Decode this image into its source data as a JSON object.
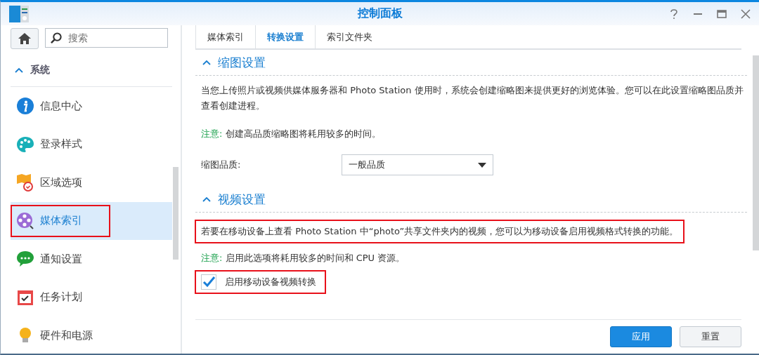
{
  "window": {
    "title": "控制面板"
  },
  "sidebar": {
    "search": {
      "placeholder": "搜索"
    },
    "group": {
      "label": "系统",
      "expanded": true
    },
    "items": [
      {
        "label": "信息中心",
        "selected": false,
        "outlined": false
      },
      {
        "label": "登录样式",
        "selected": false,
        "outlined": false
      },
      {
        "label": "区域选项",
        "selected": false,
        "outlined": false
      },
      {
        "label": "媒体索引",
        "selected": true,
        "outlined": true
      },
      {
        "label": "通知设置",
        "selected": false,
        "outlined": false
      },
      {
        "label": "任务计划",
        "selected": false,
        "outlined": false
      },
      {
        "label": "硬件和电源",
        "selected": false,
        "outlined": false
      }
    ]
  },
  "tabs": [
    {
      "label": "媒体索引",
      "selected": false
    },
    {
      "label": "转换设置",
      "selected": true
    },
    {
      "label": "索引文件夹",
      "selected": false
    }
  ],
  "sections": [
    {
      "title": "缩图设置",
      "expanded": true,
      "description": "当您上传照片或视频供媒体服务器和 Photo Station 使用时，系统会创建缩略图来提供更好的浏览体验。您可以在此设置缩略图品质并查看创建进程。",
      "note_label": "注意:",
      "note": "创建高品质缩略图将耗用较多的时间。",
      "field": {
        "label": "缩图品质:",
        "value": "一般品质"
      }
    },
    {
      "title": "视频设置",
      "expanded": true,
      "description": "若要在移动设备上查看 Photo Station 中“photo”共享文件夹内的视频，您可以为移动设备启用视频格式转换的功能。",
      "description_outlined": true,
      "note_label": "注意:",
      "note": "启用此选项将耗用较多的时间和 CPU 资源。",
      "checkbox": {
        "label": "启用移动设备视频转换",
        "checked": true,
        "outlined": true
      }
    }
  ],
  "buttons": [
    {
      "label": "应用",
      "kind": "primary"
    },
    {
      "label": "重置",
      "kind": "secondary"
    }
  ]
}
